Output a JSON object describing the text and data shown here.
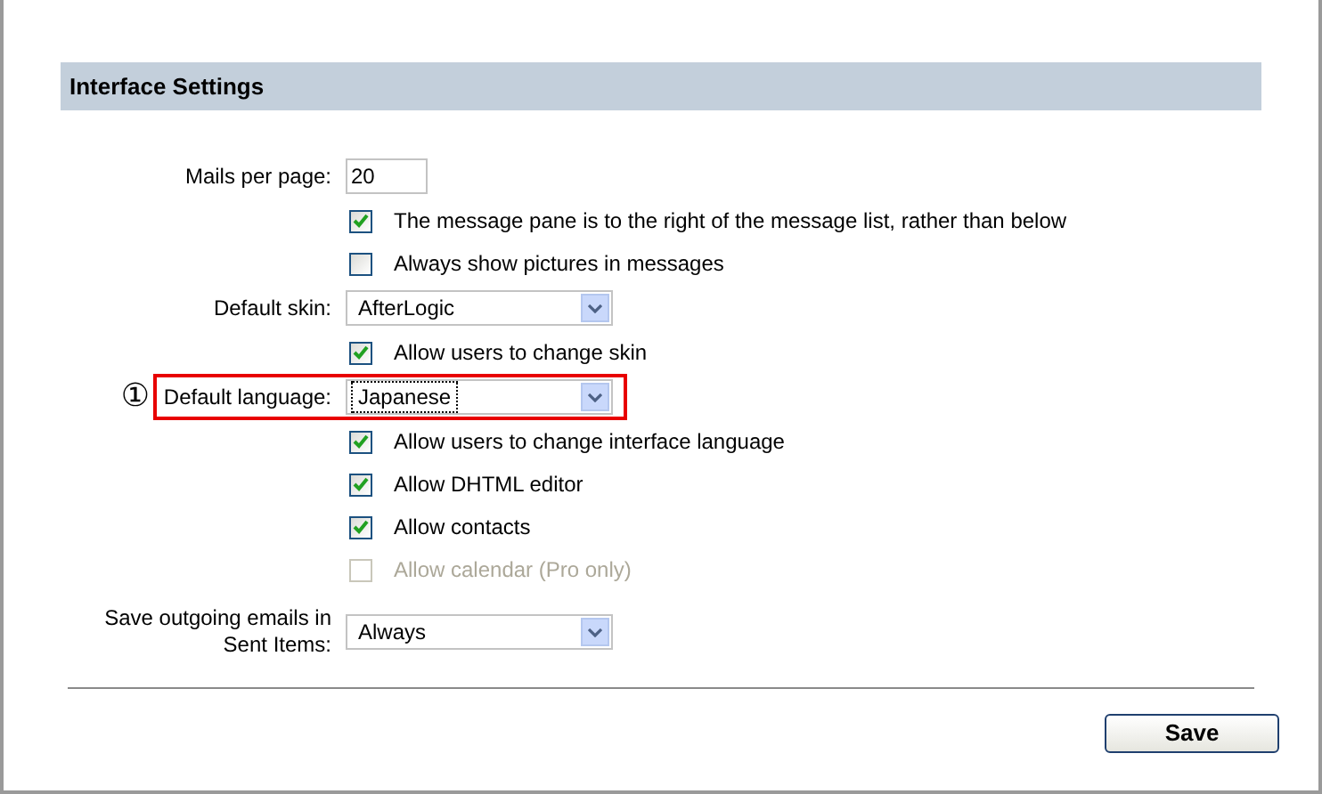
{
  "section_title": "Interface Settings",
  "rows": [
    {
      "kind": "text",
      "label": "Mails per page:",
      "value": "20"
    },
    {
      "kind": "checkbox",
      "label": "The message pane is to the right of the message list, rather than below",
      "checked": true,
      "disabled": false
    },
    {
      "kind": "checkbox",
      "label": "Always show pictures in messages",
      "checked": false,
      "disabled": false
    },
    {
      "kind": "select",
      "label": "Default skin:",
      "value": "AfterLogic",
      "highlighted": false
    },
    {
      "kind": "checkbox",
      "label": "Allow users to change skin",
      "checked": true,
      "disabled": false
    },
    {
      "kind": "select",
      "label": "Default language:",
      "value": "Japanese",
      "highlighted": true,
      "marker": "①"
    },
    {
      "kind": "checkbox",
      "label": "Allow users to change interface language",
      "checked": true,
      "disabled": false
    },
    {
      "kind": "checkbox",
      "label": "Allow DHTML editor",
      "checked": true,
      "disabled": false
    },
    {
      "kind": "checkbox",
      "label": "Allow contacts",
      "checked": true,
      "disabled": false
    },
    {
      "kind": "checkbox",
      "label": "Allow calendar (Pro only)",
      "checked": false,
      "disabled": true
    },
    {
      "kind": "select",
      "label": "Save outgoing emails in Sent Items:",
      "value": "Always",
      "highlighted": false
    }
  ],
  "save_button": "Save"
}
